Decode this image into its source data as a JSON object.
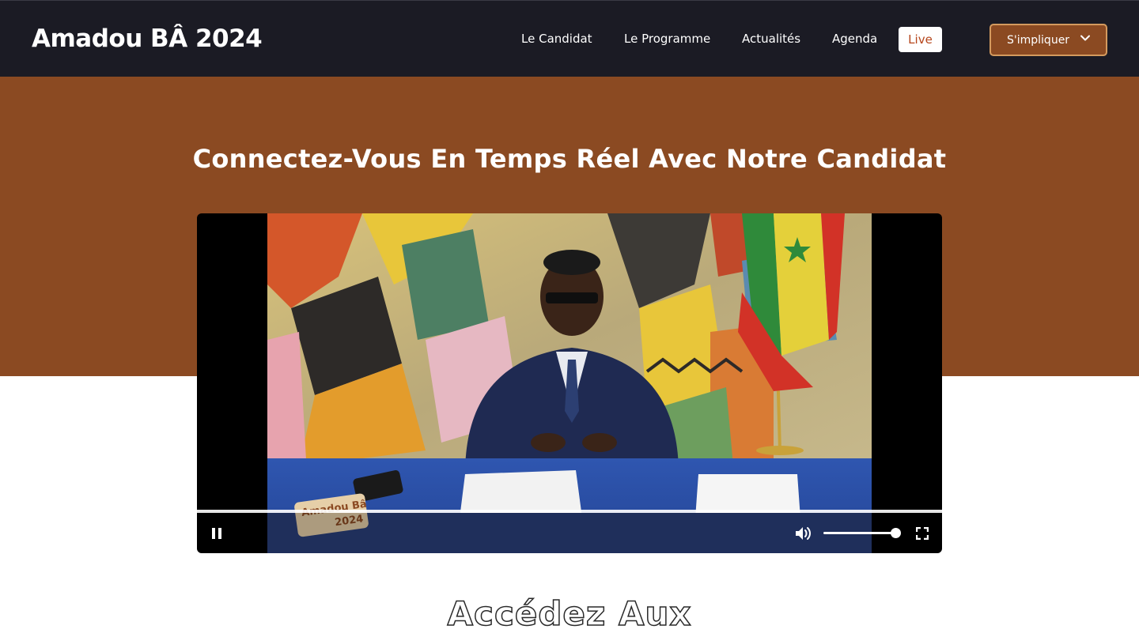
{
  "header": {
    "logo": "Amadou BÂ 2024",
    "nav": [
      {
        "label": "Le Candidat"
      },
      {
        "label": "Le Programme"
      },
      {
        "label": "Actualités"
      },
      {
        "label": "Agenda"
      },
      {
        "label": "Live"
      }
    ],
    "cta_label": "S'impliquer"
  },
  "hero": {
    "title": "Connectez-Vous En Temps Réel Avec Notre Candidat"
  },
  "video": {
    "overlay_logo_line1": "Amadou Bâ",
    "overlay_logo_line2": "2024",
    "state": "playing",
    "volume": 1.0,
    "icons": [
      "pause-icon",
      "volume-icon",
      "fullscreen-icon"
    ]
  },
  "section": {
    "heading": "Accédez Aux"
  },
  "colors": {
    "header_bg": "#1b1b24",
    "brand_brown": "#8b4a22",
    "live_text": "#b5451b",
    "cta_border": "#d49a5e"
  }
}
